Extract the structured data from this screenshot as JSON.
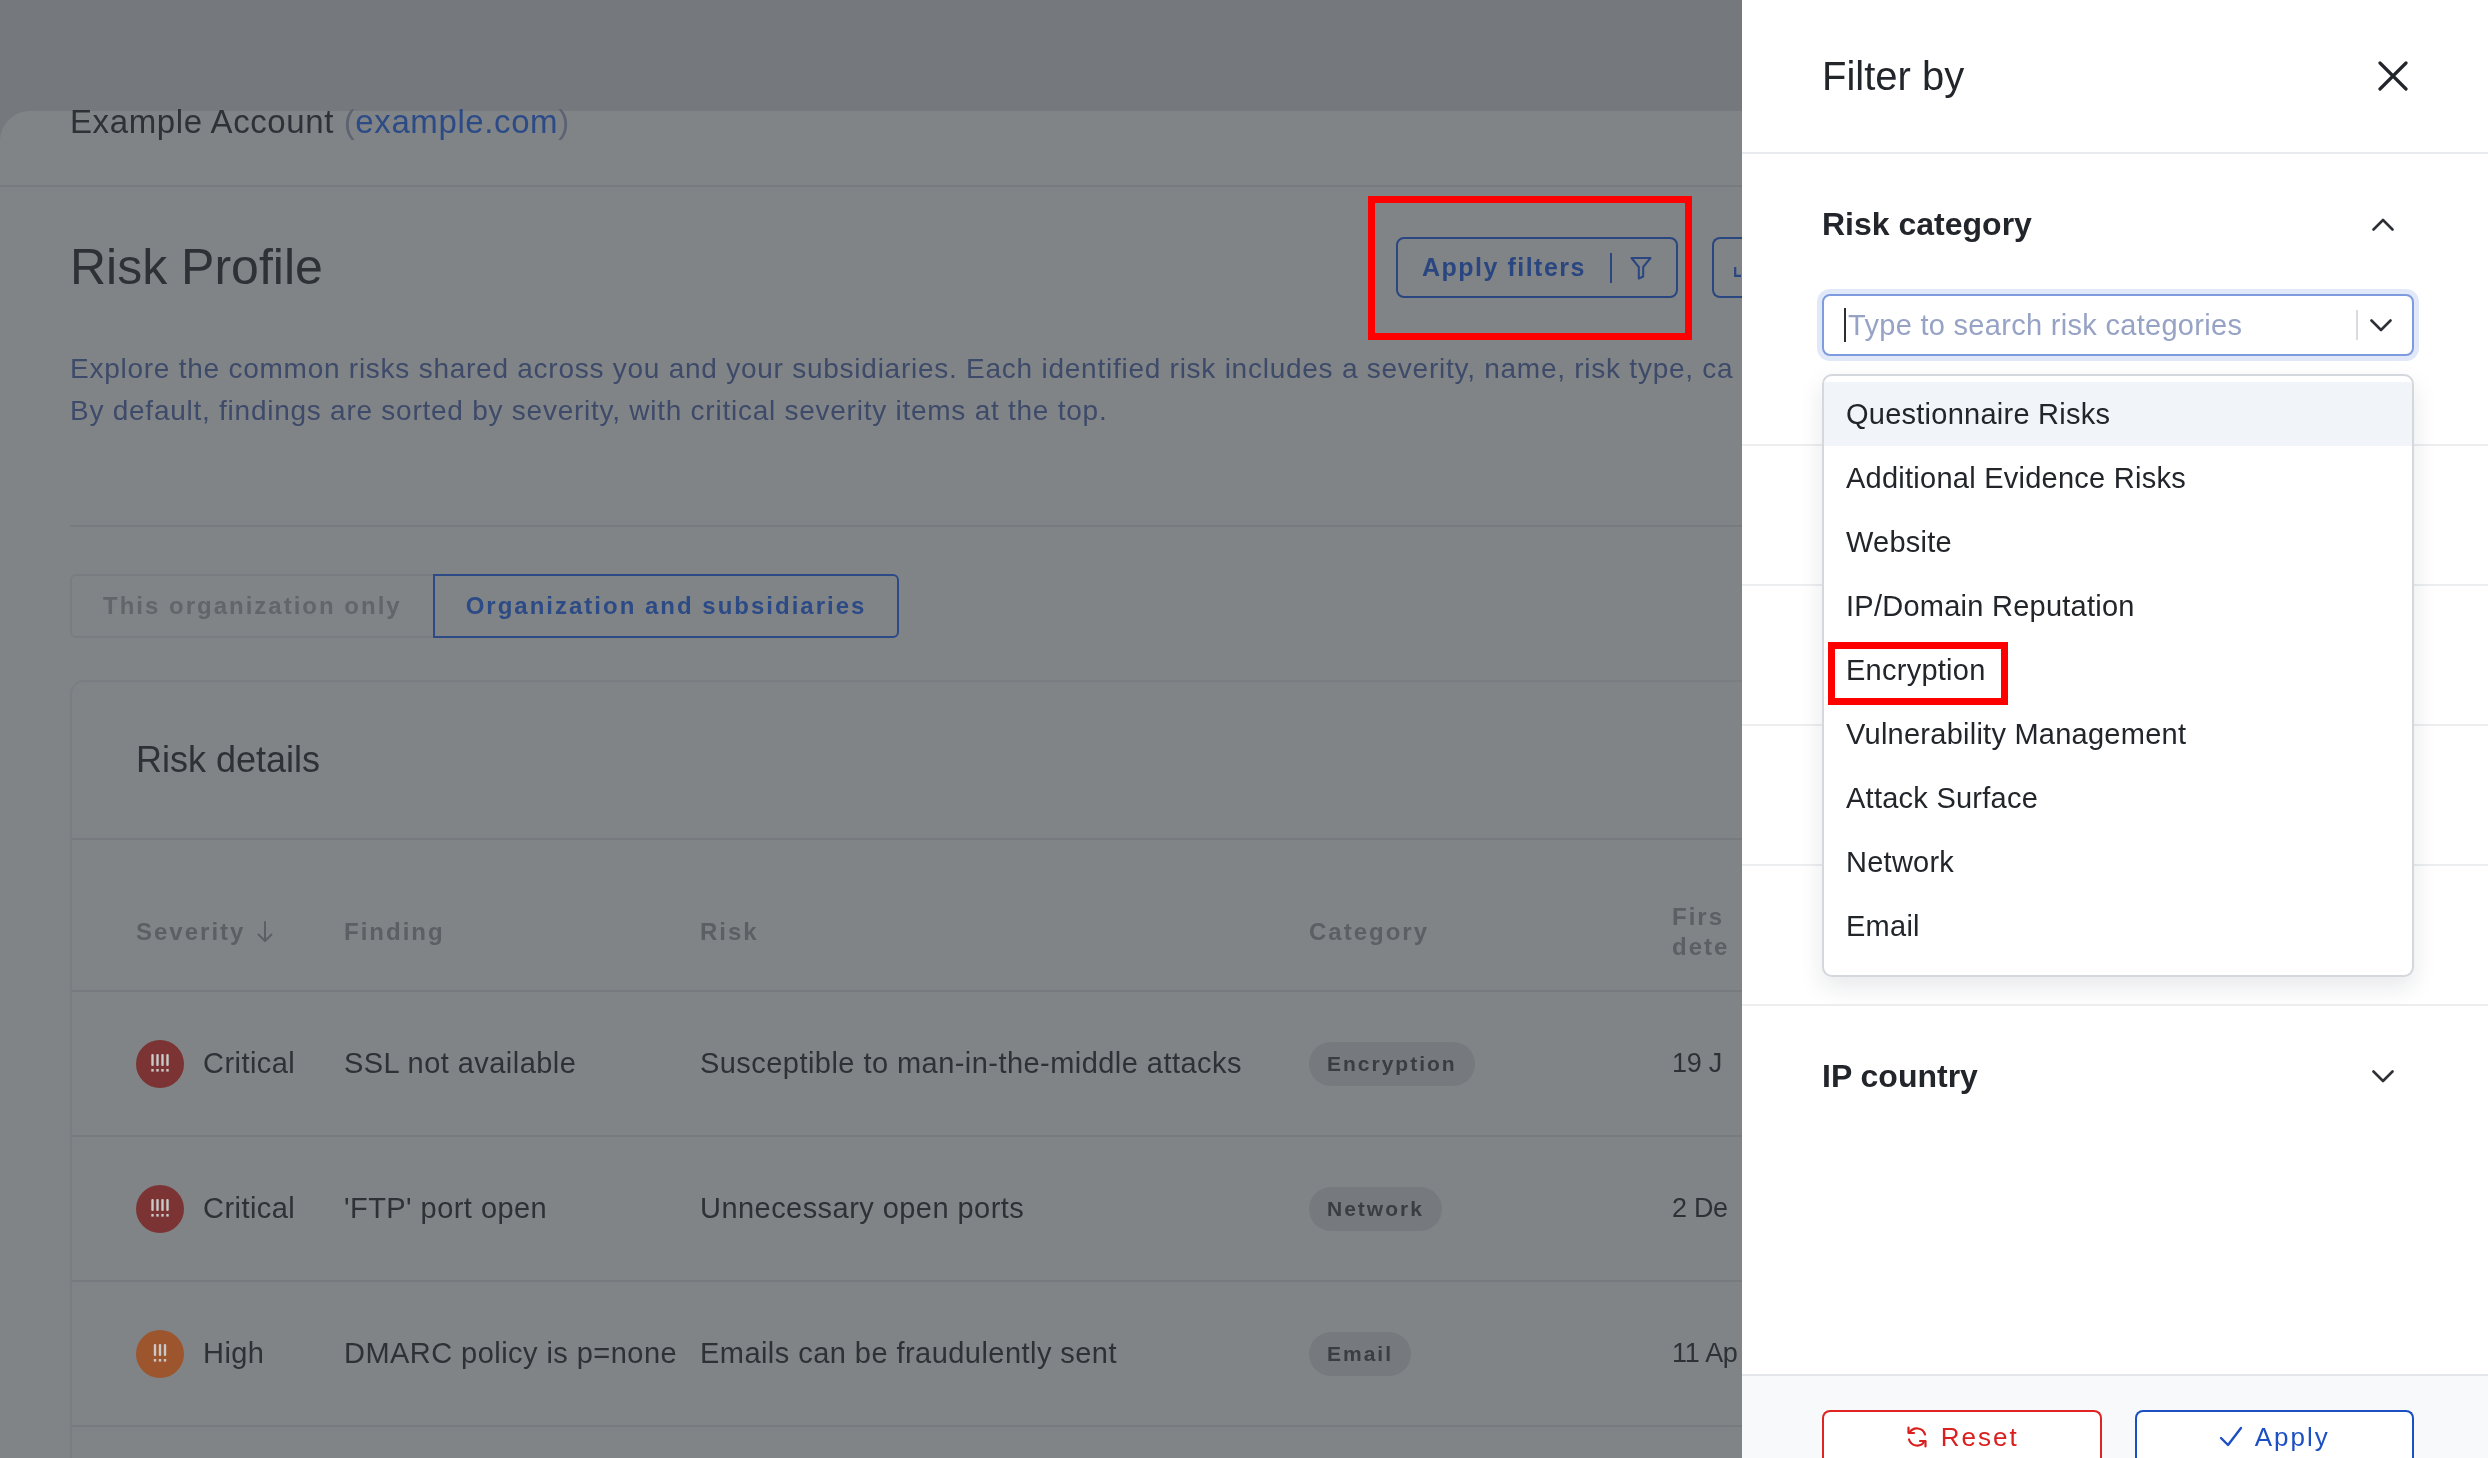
{
  "account": {
    "name": "Example Account",
    "parens": [
      "(",
      ")"
    ],
    "domain": "example.com"
  },
  "header": {
    "title": "Risk Profile",
    "buttons": [
      {
        "kind": "filter",
        "label": "Apply filters",
        "annotated": true
      },
      {
        "kind": "cut_off",
        "annotated": false
      }
    ]
  },
  "description": [
    "Explore the common risks shared across you and your subsidiaries. Each identified risk includes a severity, name, risk type, ca",
    "By default, findings are sorted by severity, with critical severity items at the top."
  ],
  "scope_tabs": [
    {
      "label": "This organization only",
      "selected": false
    },
    {
      "label": "Organization and subsidiaries",
      "selected": true
    }
  ],
  "risk_details": {
    "title": "Risk details",
    "columns": [
      {
        "label": "Severity",
        "sorted": true
      },
      {
        "label": "Finding",
        "sorted": false
      },
      {
        "label": "Risk",
        "sorted": false
      },
      {
        "label": "Category",
        "sorted": false
      },
      {
        "label": "Firs dete",
        "sorted": false
      }
    ],
    "rows": [
      {
        "severity": "Critical",
        "kind": "critical",
        "color": "#7b3333",
        "finding": "SSL not available",
        "risk": "Susceptible to man-in-the-middle attacks",
        "category": "Encryption",
        "first_detected": "19 J"
      },
      {
        "severity": "Critical",
        "kind": "critical",
        "color": "#7b3333",
        "finding": "'FTP' port open",
        "risk": "Unnecessary open ports",
        "category": "Network",
        "first_detected": "2 De"
      },
      {
        "severity": "High",
        "kind": "high",
        "color": "#9d552e",
        "finding": "DMARC policy is p=none",
        "risk": "Emails can be fraudulently sent",
        "category": "Email",
        "first_detected": "11 Ap"
      }
    ]
  },
  "drawer": {
    "title": "Filter by",
    "sections": [
      {
        "title": "Risk category",
        "expanded": true,
        "search": {
          "placeholder": "Type to search risk categories"
        },
        "options": [
          {
            "label": "Questionnaire Risks",
            "highlighted": true,
            "annotated": false
          },
          {
            "label": "Additional Evidence Risks",
            "highlighted": false,
            "annotated": false
          },
          {
            "label": "Website",
            "highlighted": false,
            "annotated": false
          },
          {
            "label": "IP/Domain Reputation",
            "highlighted": false,
            "annotated": false
          },
          {
            "label": "Encryption",
            "highlighted": false,
            "annotated": true
          },
          {
            "label": "Vulnerability Management",
            "highlighted": false,
            "annotated": false
          },
          {
            "label": "Attack Surface",
            "highlighted": false,
            "annotated": false
          },
          {
            "label": "Network",
            "highlighted": false,
            "annotated": false
          },
          {
            "label": "Email",
            "highlighted": false,
            "annotated": false
          }
        ]
      },
      {
        "title": "IP country",
        "expanded": false
      }
    ],
    "buttons": [
      {
        "kind": "reset",
        "label": "Reset"
      },
      {
        "kind": "apply",
        "label": "Apply"
      }
    ]
  }
}
